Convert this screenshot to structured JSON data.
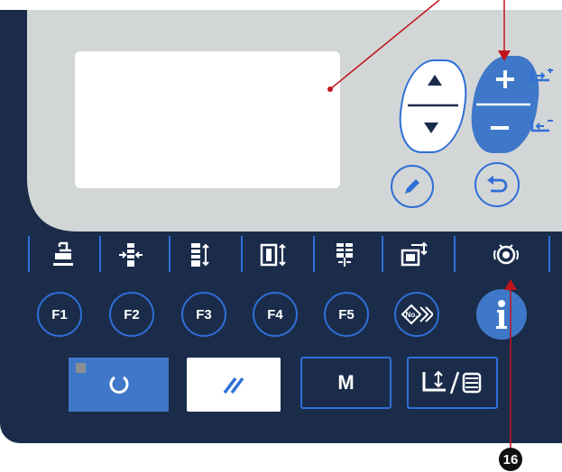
{
  "function_keys": [
    {
      "label": "F1"
    },
    {
      "label": "F2"
    },
    {
      "label": "F3"
    },
    {
      "label": "F4"
    },
    {
      "label": "F5"
    }
  ],
  "mode_button_label": "M",
  "callout_number": "16",
  "icons": {
    "up": "arrow-up-icon",
    "down": "arrow-down-icon",
    "plus": "plus-icon",
    "minus": "minus-icon",
    "edit": "pencil-icon",
    "back": "return-icon",
    "info": "info-icon",
    "reset": "reset-icon",
    "clear": "clear-icon",
    "pattern_no": "pattern-number-icon",
    "bobbin": "bobbin-counter-icon",
    "tension": "thread-tension-icon"
  },
  "colors": {
    "panel": "#1a2c4a",
    "bezel": "#d3d6d6",
    "accent_blue": "#2f6fd6",
    "button_blue": "#3f78c9",
    "indicator_gray": "#8a8f96",
    "callout_red": "#c0141c"
  }
}
